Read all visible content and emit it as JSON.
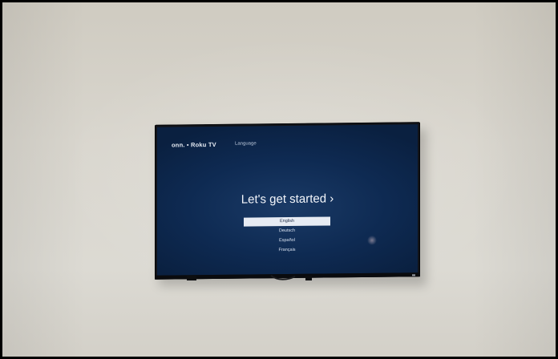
{
  "scene": {
    "description_free": true,
    "colors": {
      "wall": "#d9d6ce",
      "tv_bezel": "#111318",
      "screen_bg": "#0e2a52",
      "selected_row": "#e6ebf3"
    }
  },
  "tv": {
    "brand": "onn. • Roku TV",
    "screen_title": "Language",
    "headline": "Let's get started ›",
    "languages": [
      {
        "label": "English",
        "selected": true
      },
      {
        "label": "Deutsch",
        "selected": false
      },
      {
        "label": "Español",
        "selected": false
      },
      {
        "label": "Français",
        "selected": false
      }
    ]
  }
}
